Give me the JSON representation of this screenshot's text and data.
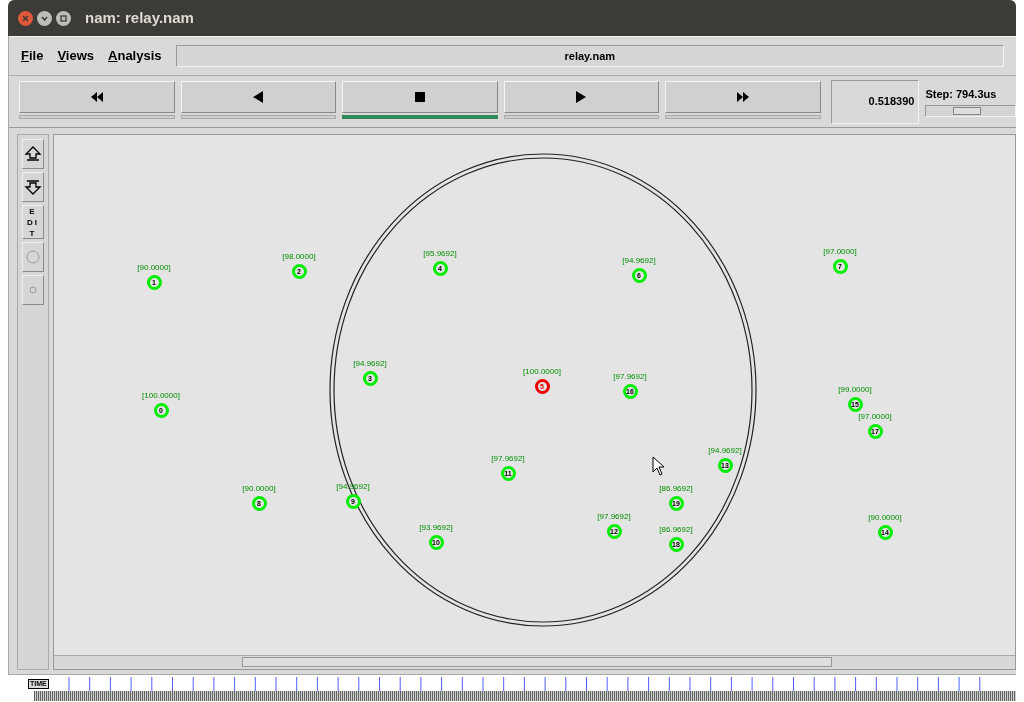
{
  "window": {
    "title": "nam: relay.nam"
  },
  "menu": [
    "File",
    "Views",
    "Analysis"
  ],
  "file_name": "relay.nam",
  "transport": [
    {
      "kind": "rewind",
      "selected": false
    },
    {
      "kind": "back",
      "selected": false
    },
    {
      "kind": "stop",
      "selected": true
    },
    {
      "kind": "play",
      "selected": false
    },
    {
      "kind": "forward",
      "selected": false
    }
  ],
  "time": "0.518390",
  "step": {
    "label": "Step: 794.3us",
    "level": 0.45
  },
  "tools": [
    {
      "kind": "up"
    },
    {
      "kind": "down"
    },
    {
      "kind": "edit",
      "label": "EDIT"
    },
    {
      "kind": "big-circle"
    },
    {
      "kind": "small-circle"
    }
  ],
  "nodes": [
    {
      "id": "1",
      "energy": "[90.0000]",
      "color": "#00ee00"
    },
    {
      "id": "2",
      "energy": "[98.0000]",
      "color": "#00ee00"
    },
    {
      "id": "4",
      "energy": "[95.9692]",
      "color": "#00ee00"
    },
    {
      "id": "6",
      "energy": "[94.9692]",
      "color": "#00ee00"
    },
    {
      "id": "7",
      "energy": "[97.0000]",
      "color": "#00ee00"
    },
    {
      "id": "3",
      "energy": "[94.9692]",
      "color": "#00ee00"
    },
    {
      "id": "5",
      "energy": "[100.0000]",
      "color": "#ee0000"
    },
    {
      "id": "16",
      "energy": "[97.9692]",
      "color": "#00ee00"
    },
    {
      "id": "0",
      "energy": "[100.0000]",
      "color": "#00ee00"
    },
    {
      "id": "15",
      "energy": "[99.0000]",
      "color": "#00ee00"
    },
    {
      "id": "17",
      "energy": "[97.0000]",
      "color": "#00ee00"
    },
    {
      "id": "11",
      "energy": "[97.9692]",
      "color": "#00ee00"
    },
    {
      "id": "13",
      "energy": "[94.9692]",
      "color": "#00ee00"
    },
    {
      "id": "8",
      "energy": "[90.0000]",
      "color": "#00ee00"
    },
    {
      "id": "9",
      "energy": "[94.9692]",
      "color": "#00ee00"
    },
    {
      "id": "19",
      "energy": "[86.9692]",
      "color": "#00ee00"
    },
    {
      "id": "10",
      "energy": "[93.9692]",
      "color": "#00ee00"
    },
    {
      "id": "12",
      "energy": "[97.9692]",
      "color": "#00ee00"
    },
    {
      "id": "18",
      "energy": "[86.9692]",
      "color": "#00ee00"
    },
    {
      "id": "14",
      "energy": "[90.0000]",
      "color": "#00ee00"
    }
  ],
  "timeline": {
    "label": "TIME"
  }
}
